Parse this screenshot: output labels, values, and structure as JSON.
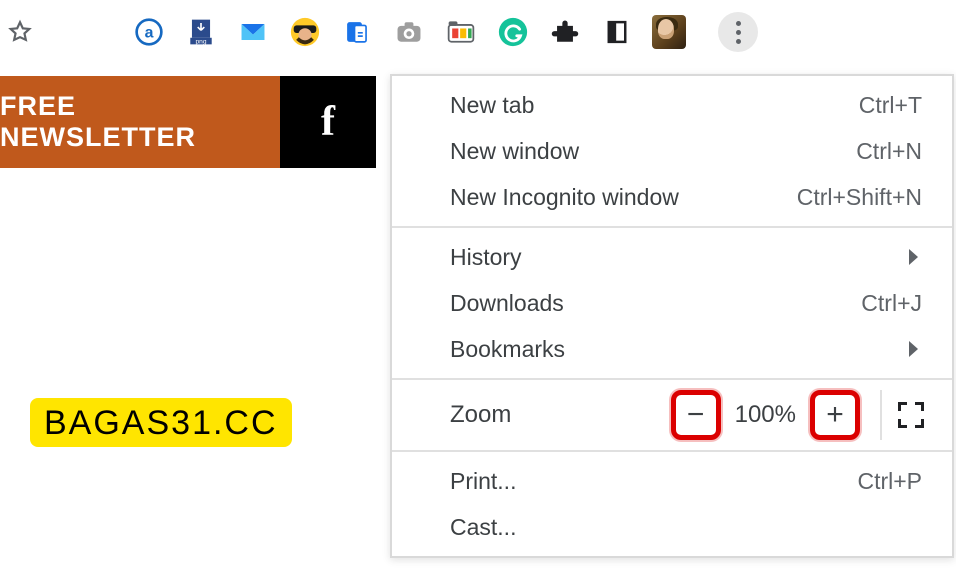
{
  "toolbar": {
    "star": "bookmark-star",
    "extensions": [
      {
        "name": "blank-extension",
        "color": ""
      },
      {
        "name": "amazon-assistant"
      },
      {
        "name": "png-download"
      },
      {
        "name": "inbox-mail"
      },
      {
        "name": "buddy-avatar"
      },
      {
        "name": "save-to-pocket"
      },
      {
        "name": "camera-screenshot"
      },
      {
        "name": "tab-snooze"
      },
      {
        "name": "grammarly"
      },
      {
        "name": "extensions-puzzle"
      },
      {
        "name": "reading-list"
      }
    ]
  },
  "page": {
    "newsletter_label": "FREE NEWSLETTER",
    "facebook_label": "f",
    "watermark": "BAGAS31.CC"
  },
  "menu": {
    "new_tab": {
      "label": "New tab",
      "shortcut": "Ctrl+T"
    },
    "new_window": {
      "label": "New window",
      "shortcut": "Ctrl+N"
    },
    "new_incognito": {
      "label": "New Incognito window",
      "shortcut": "Ctrl+Shift+N"
    },
    "history": {
      "label": "History"
    },
    "downloads": {
      "label": "Downloads",
      "shortcut": "Ctrl+J"
    },
    "bookmarks": {
      "label": "Bookmarks"
    },
    "zoom": {
      "label": "Zoom",
      "value": "100%",
      "minus": "−",
      "plus": "+"
    },
    "print": {
      "label": "Print...",
      "shortcut": "Ctrl+P"
    },
    "cast": {
      "label": "Cast..."
    }
  }
}
